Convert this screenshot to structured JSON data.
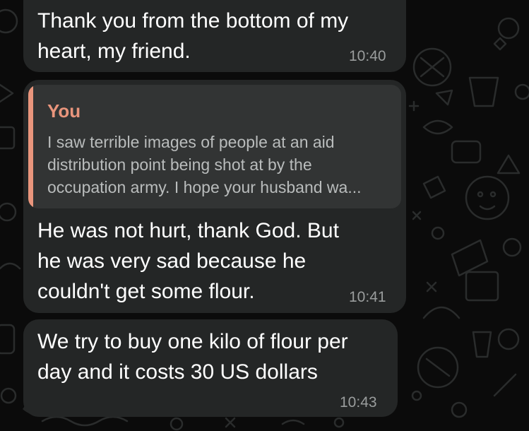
{
  "colors": {
    "background": "#0b0b0b",
    "bubble": "#242626",
    "quote_background": "#323434",
    "quote_accent": "#e9957c",
    "timestamp": "#9a9d9d"
  },
  "messages": [
    {
      "text": "Thank you from the bottom of my\nheart, my friend.",
      "time": "10:40"
    },
    {
      "quote": {
        "author": "You",
        "text": "I saw terrible images of people at an aid\ndistribution point being shot at by the\noccupation army. I hope your husband wa..."
      },
      "text": "He was not hurt, thank God.  But\nhe was very sad because he\ncouldn't get some flour.",
      "time": "10:41"
    },
    {
      "text": "We try to buy one kilo of flour per\nday and it costs 30 US dollars",
      "time": "10:43"
    }
  ]
}
